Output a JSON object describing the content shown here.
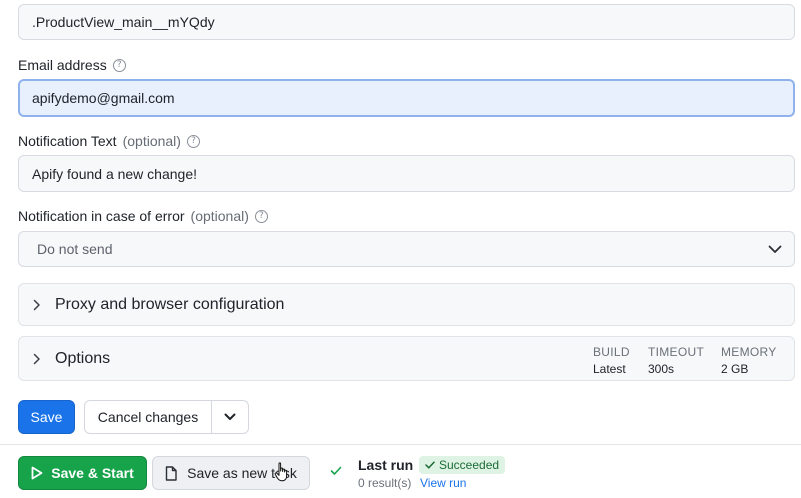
{
  "form": {
    "selector_value": ".ProductView_main__mYQdy",
    "email": {
      "label": "Email address",
      "value": "apifydemo@gmail.com"
    },
    "notification_text": {
      "label": "Notification Text",
      "optional": "(optional)",
      "value": "Apify found a new change!"
    },
    "notification_error": {
      "label": "Notification in case of error",
      "optional": "(optional)",
      "selected": "Do not send"
    }
  },
  "sections": {
    "proxy": {
      "label": "Proxy and browser configuration"
    },
    "options": {
      "label": "Options",
      "build": {
        "key": "BUILD",
        "value": "Latest"
      },
      "timeout": {
        "key": "TIMEOUT",
        "value": "300s"
      },
      "memory": {
        "key": "MEMORY",
        "value": "2 GB"
      }
    }
  },
  "actions": {
    "save": "Save",
    "cancel": "Cancel changes"
  },
  "footer": {
    "save_start": "Save & Start",
    "save_new_task": "Save as new task",
    "last_run": "Last run",
    "status": "Succeeded",
    "results": "0 result(s)",
    "view_run": "View run"
  },
  "colors": {
    "primary": "#1a73e8",
    "success": "#17a34a",
    "badge_bg": "#dff3e4"
  },
  "icons": {
    "help": "question-circle-icon",
    "chevron_down": "chevron-down-icon",
    "chevron_right": "chevron-right-icon",
    "play": "play-icon",
    "document": "document-icon",
    "check": "check-icon"
  }
}
